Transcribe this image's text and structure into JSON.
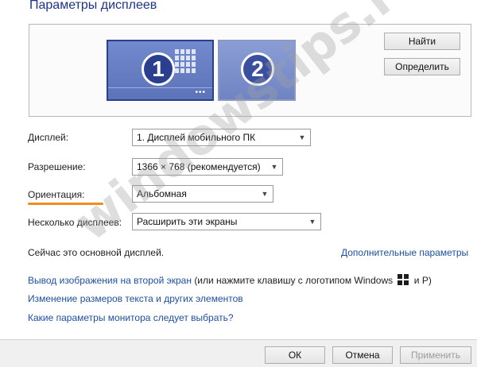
{
  "window": {
    "title": "Параметры дисплеев"
  },
  "monitors": [
    {
      "number": "1",
      "selected": true,
      "icon": "windows-start-screen-icon",
      "dots": "•••"
    },
    {
      "number": "2",
      "selected": false
    }
  ],
  "buttons": {
    "find": "Найти",
    "identify": "Определить"
  },
  "settings": {
    "display": {
      "label": "Дисплей:",
      "value": "1. Дисплей мобильного ПК"
    },
    "resolution": {
      "label": "Разрешение:",
      "value": "1366 × 768 (рекомендуется)"
    },
    "orientation": {
      "label": "Ориентация:",
      "value": "Альбомная"
    },
    "multiple": {
      "label": "Несколько дисплеев:",
      "value": "Расширить эти экраны"
    }
  },
  "status": {
    "main_display": "Сейчас это основной дисплей.",
    "advanced_link": "Дополнительные параметры"
  },
  "links": {
    "second_screen": "Вывод изображения на второй экран",
    "second_screen_hint_before": "(или нажмите клавишу с логотипом Windows",
    "second_screen_hint_after": "и P)",
    "text_size": "Изменение размеров текста и других элементов",
    "monitor_params": "Какие параметры монитора следует выбрать?"
  },
  "footer": {
    "ok": "ОК",
    "cancel": "Отмена",
    "apply": "Применить"
  },
  "watermark": "windowstips.ru",
  "colors": {
    "accent_link": "#1e4fa3",
    "title": "#1e3287",
    "monitor": "#5d73b8",
    "orientation_underline": "#f28c22"
  }
}
